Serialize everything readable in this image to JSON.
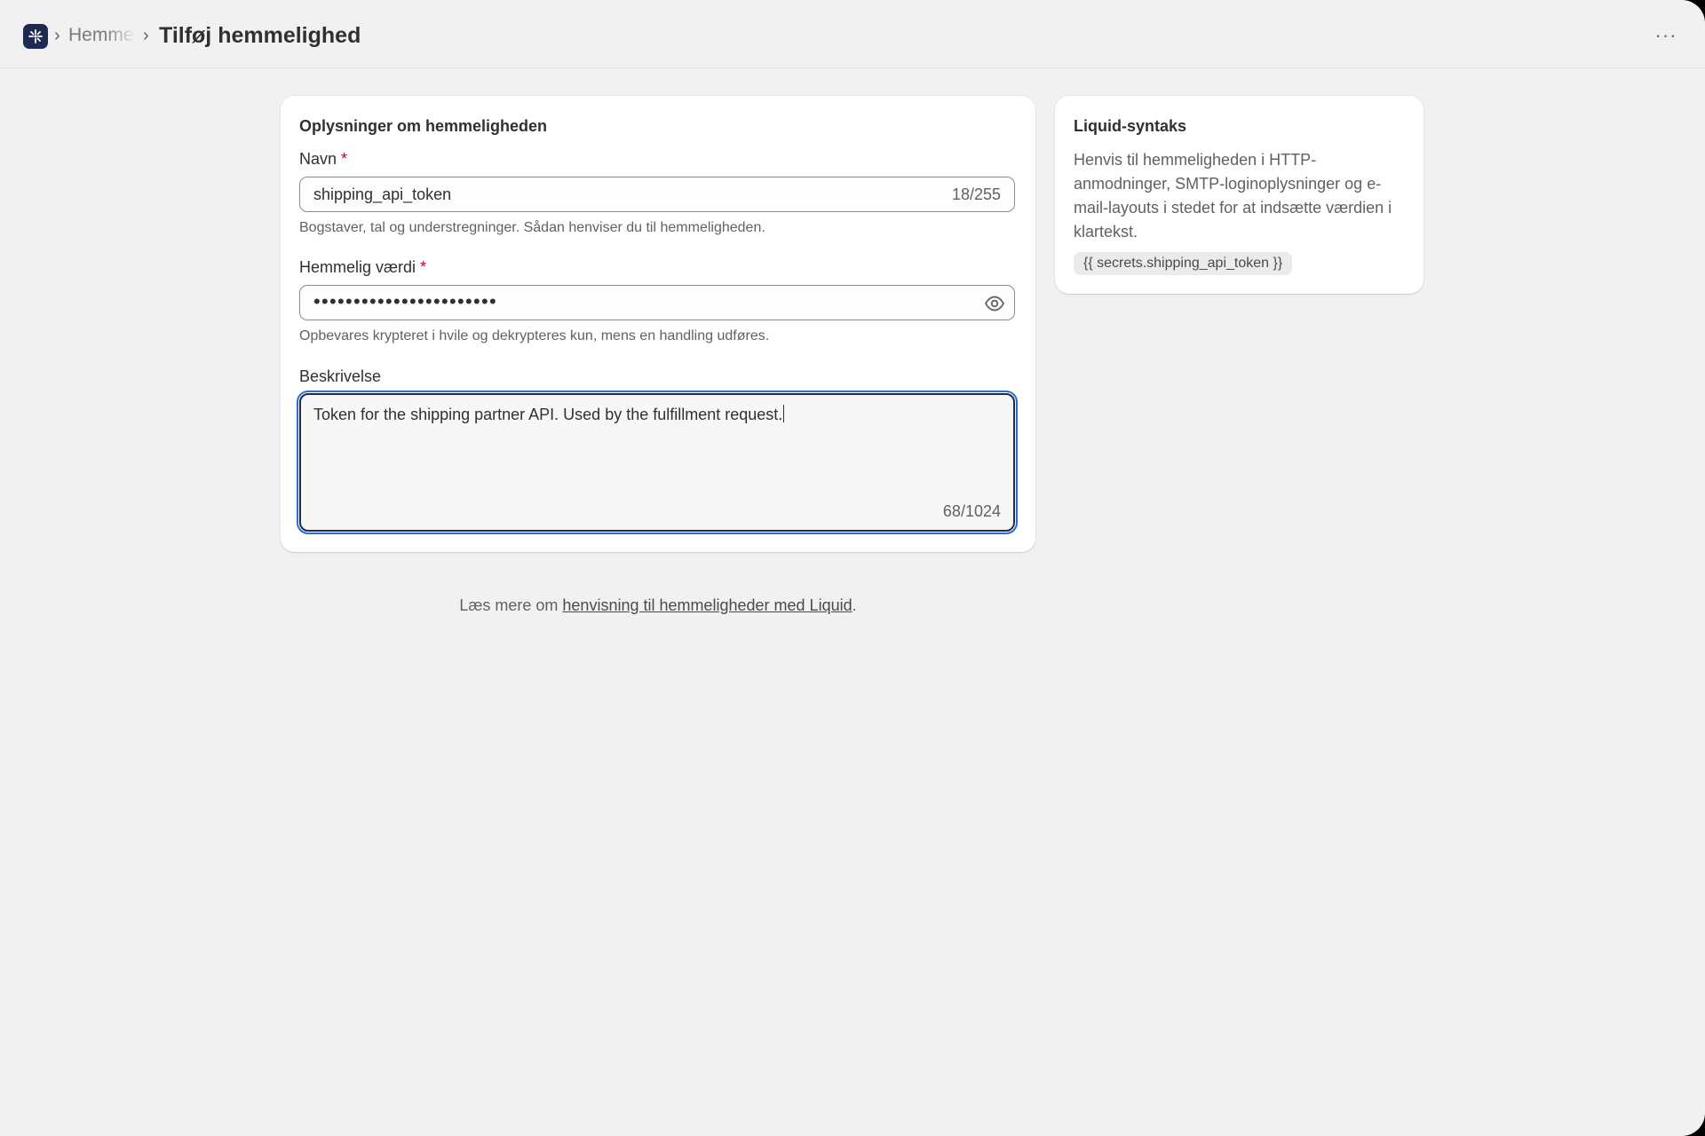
{
  "breadcrumb": {
    "parent": "Hemmeligheder",
    "separator": "›"
  },
  "page": {
    "title": "Tilføj hemmelighed",
    "more_label": "···"
  },
  "details_card": {
    "title": "Oplysninger om hemmeligheden",
    "required_mark": "*",
    "name_field": {
      "label": "Navn",
      "value": "shipping_api_token",
      "count": "18/255",
      "help": "Bogstaver, tal og understregninger. Sådan henviser du til hemmeligheden."
    },
    "secret_field": {
      "label": "Hemmelig værdi",
      "masked_value": "•••••••••••••••••••••••",
      "help": "Opbevares krypteret i hvile og dekrypteres kun, mens en handling udføres."
    },
    "description_field": {
      "label": "Beskrivelse",
      "value": "Token for the shipping partner API. Used by the fulfillment request.",
      "count": "68/1024"
    }
  },
  "liquid_card": {
    "title": "Liquid-syntaks",
    "body": "Henvis til hemmeligheden i HTTP-anmodninger, SMTP-loginoplysninger og e-mail-layouts i stedet for at indsætte værdien i klartekst.",
    "code": "{{ secrets.shipping_api_token }}"
  },
  "footer": {
    "prefix": "Læs mere om ",
    "link": "henvisning til hemmeligheder med Liquid",
    "suffix": "."
  },
  "colors": {
    "background": "#f1f1f1",
    "card": "#ffffff",
    "logo": "#1f2a52",
    "focus_ring": "#2c6ecb",
    "required": "#c4003a"
  }
}
